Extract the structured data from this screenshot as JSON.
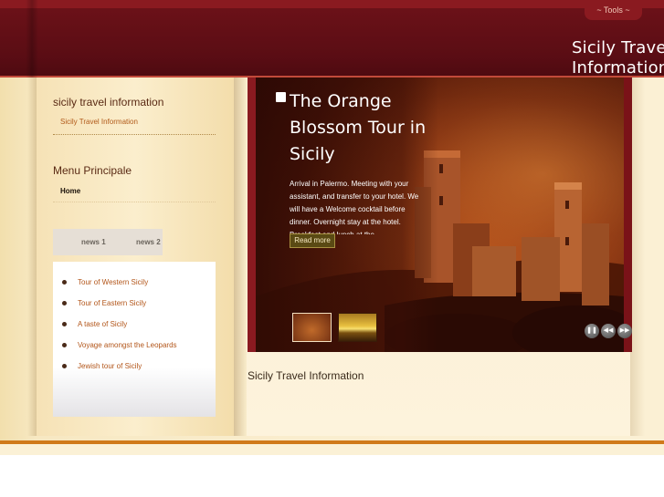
{
  "header": {
    "tools_label": "~ Tools ~",
    "site_title_line1": "Sicily Travel",
    "site_title_line2": "Information"
  },
  "sidebar": {
    "module1_title": "sicily travel information",
    "module1_link": "Sicily Travel Information",
    "module2_title": "Menu Principale",
    "menu_items": [
      "Home"
    ],
    "news_tabs": [
      "news 1",
      "news 2"
    ],
    "news_items": [
      "Tour of Western Sicily",
      "Tour of Eastern Sicily",
      "A taste of Sicily",
      "Voyage amongst the Leopards",
      "Jewish tour of Sicily"
    ]
  },
  "slideshow": {
    "title": "The Orange Blossom Tour in Sicily",
    "text": "Arrival in Palermo. Meeting with your assistant, and transfer to your hotel. We will have a Welcome cocktail before dinner. Overnight stay at the hotel. Breakfast and lunch at the",
    "read_more": "Read more",
    "controls": [
      "pause-icon",
      "previous-icon",
      "next-icon"
    ]
  },
  "main": {
    "heading": "Sicily Travel Information"
  },
  "colors": {
    "header_dark": "#5a0d14",
    "accent_orange": "#d07a1a",
    "link_orange": "#b25519"
  }
}
